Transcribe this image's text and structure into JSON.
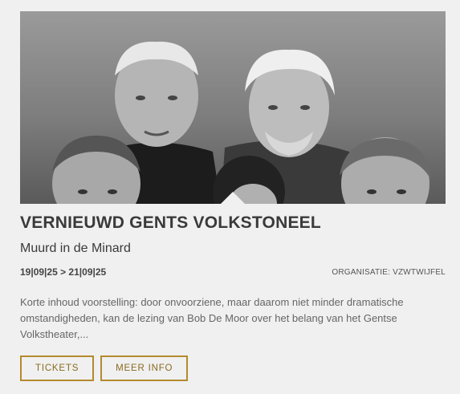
{
  "event": {
    "title": "VERNIEUWD GENTS VOLKSTONEEL",
    "subtitle": "Muurd in de Minard",
    "dates": "19|09|25 > 21|09|25",
    "organisation": "ORGANISATIE: VZWTWIJFEL",
    "description": "Korte inhoud voorstelling: door onvoorziene, maar daarom niet minder dramatische omstandigheden, kan de lezing van Bob De Moor over het belang van het Gentse Volkstheater,..."
  },
  "buttons": {
    "tickets": "TICKETS",
    "more_info": "MEER INFO"
  },
  "colors": {
    "accent": "#b38a2e",
    "background": "#f0f0f0",
    "title": "#3a3a3a"
  }
}
